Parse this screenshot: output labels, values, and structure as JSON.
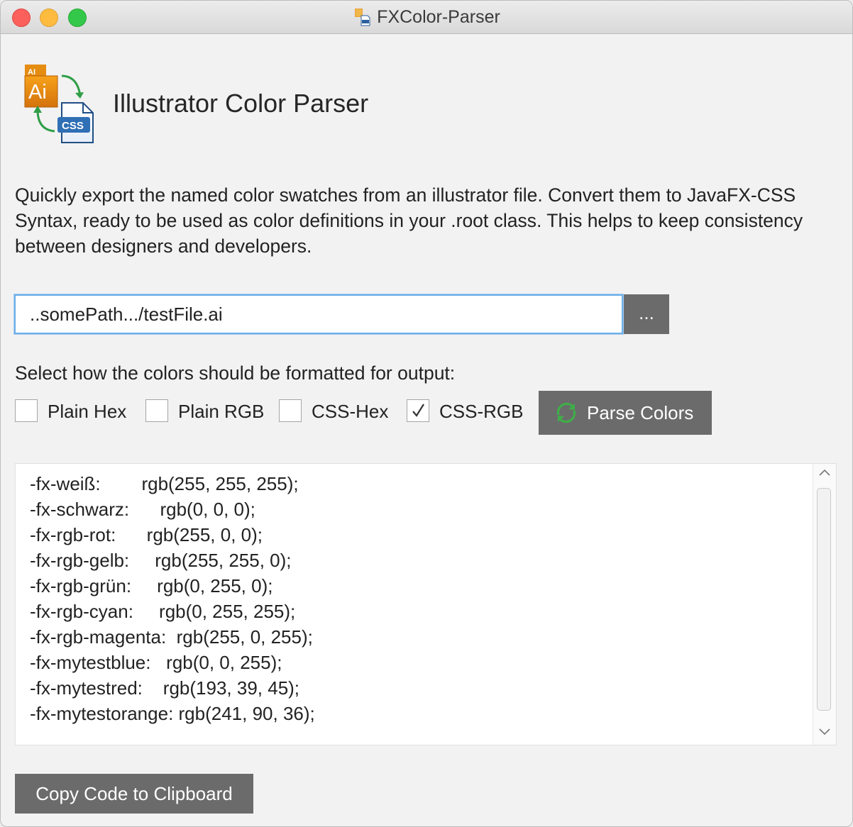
{
  "window": {
    "title": "FXColor-Parser"
  },
  "header": {
    "logo_ai_text": "Ai",
    "logo_ai_badge": "AI",
    "logo_css_text": "CSS",
    "heading": "Illustrator Color Parser"
  },
  "description": "Quickly export the named color swatches from an illustrator file. Convert them to JavaFX-CSS Syntax, ready to be used as color definitions in your .root class. This helps to keep consistency between designers and developers.",
  "file": {
    "path_value": "..somePath.../testFile.ai",
    "browse_label": "..."
  },
  "format": {
    "prompt": "Select how the colors should be formatted for output:",
    "options": [
      {
        "label": "Plain Hex",
        "checked": false
      },
      {
        "label": "Plain RGB",
        "checked": false
      },
      {
        "label": "CSS-Hex",
        "checked": false
      },
      {
        "label": "CSS-RGB",
        "checked": true
      }
    ],
    "parse_label": "Parse Colors"
  },
  "output": {
    "lines": [
      "-fx-weiß:        rgb(255, 255, 255);",
      "-fx-schwarz:      rgb(0, 0, 0);",
      "-fx-rgb-rot:      rgb(255, 0, 0);",
      "-fx-rgb-gelb:     rgb(255, 255, 0);",
      "-fx-rgb-grün:     rgb(0, 255, 0);",
      "-fx-rgb-cyan:     rgb(0, 255, 255);",
      "-fx-rgb-magenta:  rgb(255, 0, 255);",
      "-fx-mytestblue:   rgb(0, 0, 255);",
      "-fx-mytestred:    rgb(193, 39, 45);",
      "-fx-mytestorange: rgb(241, 90, 36);"
    ]
  },
  "copy_label": "Copy Code to Clipboard",
  "colors": {
    "button_bg": "#6b6b6b",
    "focus_ring": "#6aaee8",
    "parse_icon": "#3fae49"
  }
}
